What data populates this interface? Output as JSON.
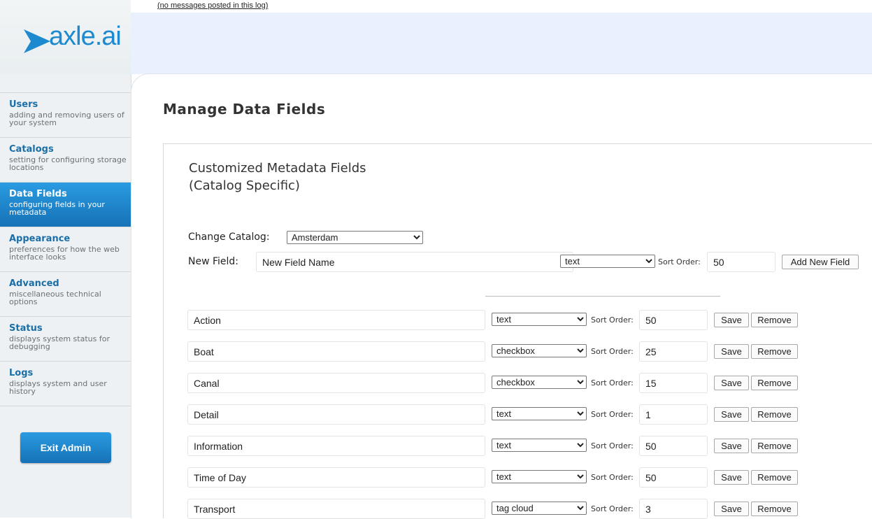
{
  "messages": {
    "link": "(no messages posted in this log)"
  },
  "logo": {
    "text": "axle.ai"
  },
  "nav": [
    {
      "title": "Users",
      "desc": "adding and removing users of your system",
      "active": false
    },
    {
      "title": "Catalogs",
      "desc": "setting for configuring storage locations",
      "active": false
    },
    {
      "title": "Data Fields",
      "desc": "configuring fields in your metadata",
      "active": true
    },
    {
      "title": "Appearance",
      "desc": "preferences for how the web interface looks",
      "active": false
    },
    {
      "title": "Advanced",
      "desc": "miscellaneous technical options",
      "active": false
    },
    {
      "title": "Status",
      "desc": "displays system status for debugging",
      "active": false
    },
    {
      "title": "Logs",
      "desc": "displays system and user history",
      "active": false
    }
  ],
  "exit_button": "Exit Admin",
  "page_title": "Manage Data Fields",
  "section": {
    "title_line1": "Customized Metadata Fields",
    "title_line2": "(Catalog Specific)"
  },
  "change_catalog": {
    "label": "Change Catalog:",
    "value": "Amsterdam"
  },
  "new_field": {
    "label": "New Field:",
    "name_value": "New Field Name",
    "type_value": "text",
    "sort_label": "Sort Order:",
    "sort_value": "50",
    "add_button": "Add New Field"
  },
  "row_labels": {
    "sort": "Sort Order:",
    "save": "Save",
    "remove": "Remove"
  },
  "fields": [
    {
      "name": "Action",
      "type": "text",
      "sort": "50"
    },
    {
      "name": "Boat",
      "type": "checkbox",
      "sort": "25"
    },
    {
      "name": "Canal",
      "type": "checkbox",
      "sort": "15"
    },
    {
      "name": "Detail",
      "type": "text",
      "sort": "1"
    },
    {
      "name": "Information",
      "type": "text",
      "sort": "50"
    },
    {
      "name": "Time of Day",
      "type": "text",
      "sort": "50"
    },
    {
      "name": "Transport",
      "type": "tag cloud",
      "sort": "3"
    }
  ],
  "colors": {
    "accent": "#1d8ad0",
    "nav_active": "#1a84c9",
    "top_bar": "#eaf1fe",
    "sidebar": "#eef1f3"
  }
}
